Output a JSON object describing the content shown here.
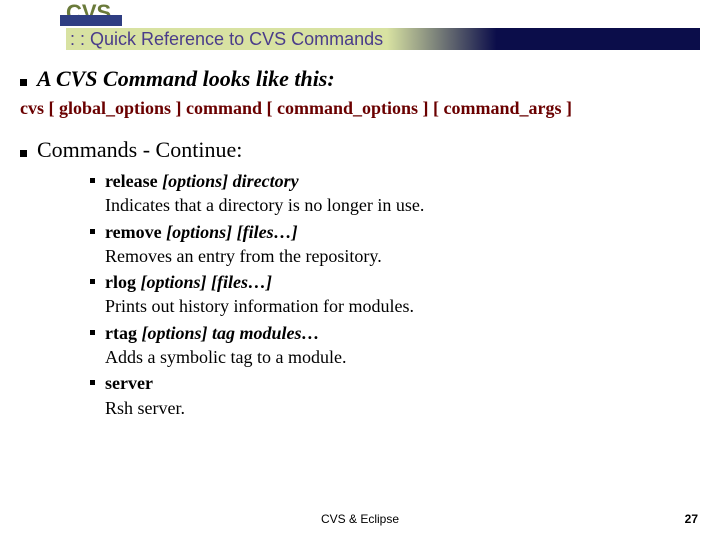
{
  "header": {
    "title": "CVS",
    "subtitle": ": : Quick Reference to CVS Commands"
  },
  "section1": {
    "heading": "A CVS Command looks like this:",
    "syntax": "cvs [ global_options ] command [ command_options ] [ command_args ]"
  },
  "section2": {
    "heading": "Commands - Continue:",
    "items": [
      {
        "cmd": "release",
        "opts": "[options]",
        "args_italic": "directory",
        "args_plain": "",
        "desc": "Indicates that a directory is no longer in use."
      },
      {
        "cmd": "remove",
        "opts": "[options]",
        "args_italic": "[files…]",
        "args_plain": "",
        "desc": "Removes an entry from the repository."
      },
      {
        "cmd": "rlog",
        "opts": "[options]",
        "args_italic": "[files…]",
        "args_plain": "",
        "desc": "Prints out history information for modules."
      },
      {
        "cmd": "rtag",
        "opts": "[options]",
        "args_italic": "tag modules…",
        "args_plain": "",
        "desc": "Adds a symbolic tag to a module."
      },
      {
        "cmd": "server",
        "opts": "",
        "args_italic": "",
        "args_plain": "",
        "desc": "Rsh server."
      }
    ]
  },
  "footer": {
    "text": "CVS & Eclipse",
    "page": "27"
  }
}
